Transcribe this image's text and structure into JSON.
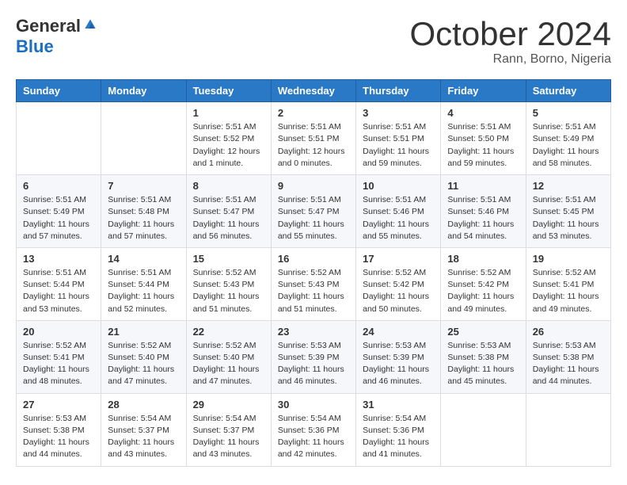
{
  "logo": {
    "general": "General",
    "blue": "Blue"
  },
  "title": {
    "month": "October 2024",
    "location": "Rann, Borno, Nigeria"
  },
  "headers": [
    "Sunday",
    "Monday",
    "Tuesday",
    "Wednesday",
    "Thursday",
    "Friday",
    "Saturday"
  ],
  "weeks": [
    [
      {
        "day": "",
        "info": ""
      },
      {
        "day": "",
        "info": ""
      },
      {
        "day": "1",
        "info": "Sunrise: 5:51 AM\nSunset: 5:52 PM\nDaylight: 12 hours and 1 minute."
      },
      {
        "day": "2",
        "info": "Sunrise: 5:51 AM\nSunset: 5:51 PM\nDaylight: 12 hours and 0 minutes."
      },
      {
        "day": "3",
        "info": "Sunrise: 5:51 AM\nSunset: 5:51 PM\nDaylight: 11 hours and 59 minutes."
      },
      {
        "day": "4",
        "info": "Sunrise: 5:51 AM\nSunset: 5:50 PM\nDaylight: 11 hours and 59 minutes."
      },
      {
        "day": "5",
        "info": "Sunrise: 5:51 AM\nSunset: 5:49 PM\nDaylight: 11 hours and 58 minutes."
      }
    ],
    [
      {
        "day": "6",
        "info": "Sunrise: 5:51 AM\nSunset: 5:49 PM\nDaylight: 11 hours and 57 minutes."
      },
      {
        "day": "7",
        "info": "Sunrise: 5:51 AM\nSunset: 5:48 PM\nDaylight: 11 hours and 57 minutes."
      },
      {
        "day": "8",
        "info": "Sunrise: 5:51 AM\nSunset: 5:47 PM\nDaylight: 11 hours and 56 minutes."
      },
      {
        "day": "9",
        "info": "Sunrise: 5:51 AM\nSunset: 5:47 PM\nDaylight: 11 hours and 55 minutes."
      },
      {
        "day": "10",
        "info": "Sunrise: 5:51 AM\nSunset: 5:46 PM\nDaylight: 11 hours and 55 minutes."
      },
      {
        "day": "11",
        "info": "Sunrise: 5:51 AM\nSunset: 5:46 PM\nDaylight: 11 hours and 54 minutes."
      },
      {
        "day": "12",
        "info": "Sunrise: 5:51 AM\nSunset: 5:45 PM\nDaylight: 11 hours and 53 minutes."
      }
    ],
    [
      {
        "day": "13",
        "info": "Sunrise: 5:51 AM\nSunset: 5:44 PM\nDaylight: 11 hours and 53 minutes."
      },
      {
        "day": "14",
        "info": "Sunrise: 5:51 AM\nSunset: 5:44 PM\nDaylight: 11 hours and 52 minutes."
      },
      {
        "day": "15",
        "info": "Sunrise: 5:52 AM\nSunset: 5:43 PM\nDaylight: 11 hours and 51 minutes."
      },
      {
        "day": "16",
        "info": "Sunrise: 5:52 AM\nSunset: 5:43 PM\nDaylight: 11 hours and 51 minutes."
      },
      {
        "day": "17",
        "info": "Sunrise: 5:52 AM\nSunset: 5:42 PM\nDaylight: 11 hours and 50 minutes."
      },
      {
        "day": "18",
        "info": "Sunrise: 5:52 AM\nSunset: 5:42 PM\nDaylight: 11 hours and 49 minutes."
      },
      {
        "day": "19",
        "info": "Sunrise: 5:52 AM\nSunset: 5:41 PM\nDaylight: 11 hours and 49 minutes."
      }
    ],
    [
      {
        "day": "20",
        "info": "Sunrise: 5:52 AM\nSunset: 5:41 PM\nDaylight: 11 hours and 48 minutes."
      },
      {
        "day": "21",
        "info": "Sunrise: 5:52 AM\nSunset: 5:40 PM\nDaylight: 11 hours and 47 minutes."
      },
      {
        "day": "22",
        "info": "Sunrise: 5:52 AM\nSunset: 5:40 PM\nDaylight: 11 hours and 47 minutes."
      },
      {
        "day": "23",
        "info": "Sunrise: 5:53 AM\nSunset: 5:39 PM\nDaylight: 11 hours and 46 minutes."
      },
      {
        "day": "24",
        "info": "Sunrise: 5:53 AM\nSunset: 5:39 PM\nDaylight: 11 hours and 46 minutes."
      },
      {
        "day": "25",
        "info": "Sunrise: 5:53 AM\nSunset: 5:38 PM\nDaylight: 11 hours and 45 minutes."
      },
      {
        "day": "26",
        "info": "Sunrise: 5:53 AM\nSunset: 5:38 PM\nDaylight: 11 hours and 44 minutes."
      }
    ],
    [
      {
        "day": "27",
        "info": "Sunrise: 5:53 AM\nSunset: 5:38 PM\nDaylight: 11 hours and 44 minutes."
      },
      {
        "day": "28",
        "info": "Sunrise: 5:54 AM\nSunset: 5:37 PM\nDaylight: 11 hours and 43 minutes."
      },
      {
        "day": "29",
        "info": "Sunrise: 5:54 AM\nSunset: 5:37 PM\nDaylight: 11 hours and 43 minutes."
      },
      {
        "day": "30",
        "info": "Sunrise: 5:54 AM\nSunset: 5:36 PM\nDaylight: 11 hours and 42 minutes."
      },
      {
        "day": "31",
        "info": "Sunrise: 5:54 AM\nSunset: 5:36 PM\nDaylight: 11 hours and 41 minutes."
      },
      {
        "day": "",
        "info": ""
      },
      {
        "day": "",
        "info": ""
      }
    ]
  ]
}
